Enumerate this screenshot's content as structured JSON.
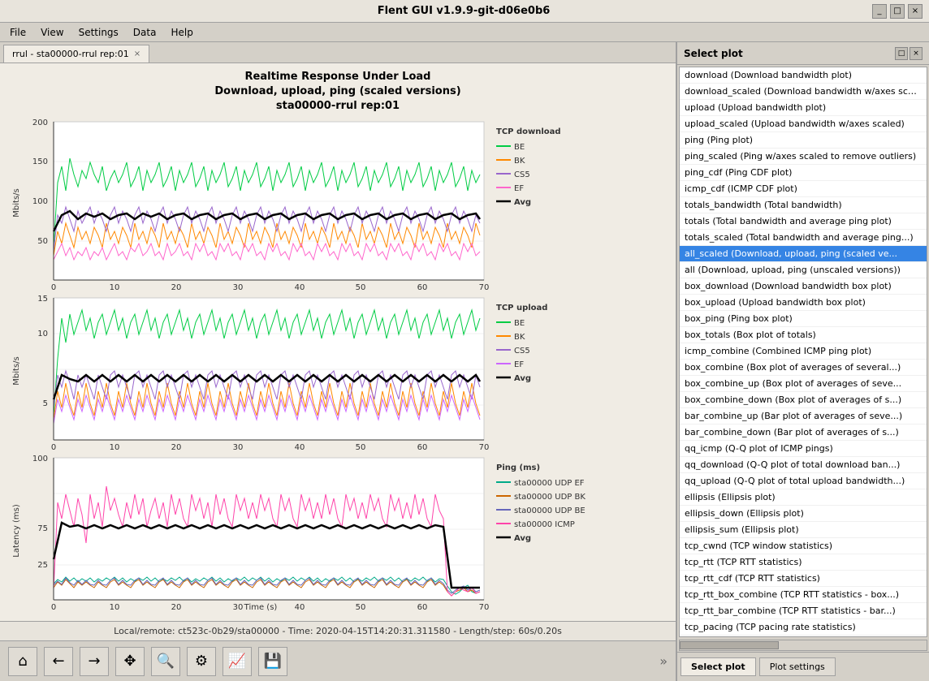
{
  "titlebar": {
    "title": "Flent GUI v1.9.9-git-d06e0b6",
    "controls": [
      "_",
      "□",
      "×"
    ]
  },
  "menubar": {
    "items": [
      "File",
      "View",
      "Settings",
      "Data",
      "Help"
    ]
  },
  "tab": {
    "label": "rrul - sta00000-rrul rep:01",
    "close": "×"
  },
  "chart": {
    "title_line1": "Realtime Response Under Load",
    "title_line2": "Download, upload, ping (scaled versions)",
    "title_line3": "sta00000-rrul rep:01",
    "status": "Local/remote: ct523c-0b29/sta00000 - Time: 2020-04-15T14:20:31.311580 - Length/step: 60s/0.20s"
  },
  "right_panel": {
    "title": "Select plot",
    "items": [
      "download (Download bandwidth plot)",
      "download_scaled (Download bandwidth w/axes scaled)",
      "upload (Upload bandwidth plot)",
      "upload_scaled (Upload bandwidth w/axes scaled)",
      "ping (Ping plot)",
      "ping_scaled (Ping w/axes scaled to remove outliers)",
      "ping_cdf (Ping CDF plot)",
      "icmp_cdf (ICMP CDF plot)",
      "totals_bandwidth (Total bandwidth)",
      "totals (Total bandwidth and average ping plot)",
      "totals_scaled (Total bandwidth and average ping...)",
      "all_scaled (Download, upload, ping (scaled ve...",
      "all (Download, upload, ping (unscaled versions))",
      "box_download (Download bandwidth box plot)",
      "box_upload (Upload bandwidth box plot)",
      "box_ping (Ping box plot)",
      "box_totals (Box plot of totals)",
      "icmp_combine (Combined ICMP ping plot)",
      "box_combine (Box plot of averages of several...)",
      "box_combine_up (Box plot of averages of seve...",
      "box_combine_down (Box plot of averages of s...)",
      "bar_combine_up (Bar plot of averages of seve...)",
      "bar_combine_down (Bar plot of averages of s...)",
      "qq_icmp (Q-Q plot of ICMP pings)",
      "qq_download (Q-Q plot of total download ban...)",
      "qq_upload (Q-Q plot of total upload bandwidth...)",
      "ellipsis (Ellipsis plot)",
      "ellipsis_down (Ellipsis plot)",
      "ellipsis_sum (Ellipsis plot)",
      "tcp_cwnd (TCP window statistics)",
      "tcp_rtt (TCP RTT statistics)",
      "tcp_rtt_cdf (TCP RTT statistics)",
      "tcp_rtt_box_combine (TCP RTT statistics - box...)",
      "tcp_rtt_bar_combine (TCP RTT statistics - bar...)",
      "tcp_pacing (TCP pacing rate statistics)"
    ],
    "selected_index": 11,
    "tabs": [
      "Select plot",
      "Plot settings"
    ]
  },
  "toolbar": {
    "buttons": [
      "home",
      "back",
      "forward",
      "move",
      "search",
      "settings",
      "chart",
      "save"
    ]
  },
  "legend": {
    "download": {
      "title": "TCP download",
      "items": [
        {
          "label": "BE",
          "color": "#00cc44"
        },
        {
          "label": "BK",
          "color": "#ff8800"
        },
        {
          "label": "CS5",
          "color": "#9966cc"
        },
        {
          "label": "EF",
          "color": "#ff66cc"
        },
        {
          "label": "Avg",
          "color": "#000000",
          "bold": true
        }
      ]
    },
    "upload": {
      "title": "TCP upload",
      "items": [
        {
          "label": "BE",
          "color": "#00cc44"
        },
        {
          "label": "BK",
          "color": "#ff8800"
        },
        {
          "label": "CS5",
          "color": "#9966cc"
        },
        {
          "label": "EF",
          "color": "#cc66ff"
        },
        {
          "label": "Avg",
          "color": "#000000",
          "bold": true
        }
      ]
    },
    "ping": {
      "title": "Ping (ms)",
      "items": [
        {
          "label": "sta00000 UDP EF",
          "color": "#00aa88"
        },
        {
          "label": "sta00000 UDP BK",
          "color": "#cc6600"
        },
        {
          "label": "sta00000 UDP BE",
          "color": "#6666bb"
        },
        {
          "label": "sta00000 ICMP",
          "color": "#ff44aa"
        },
        {
          "label": "Avg",
          "color": "#000000",
          "bold": true
        }
      ]
    }
  }
}
